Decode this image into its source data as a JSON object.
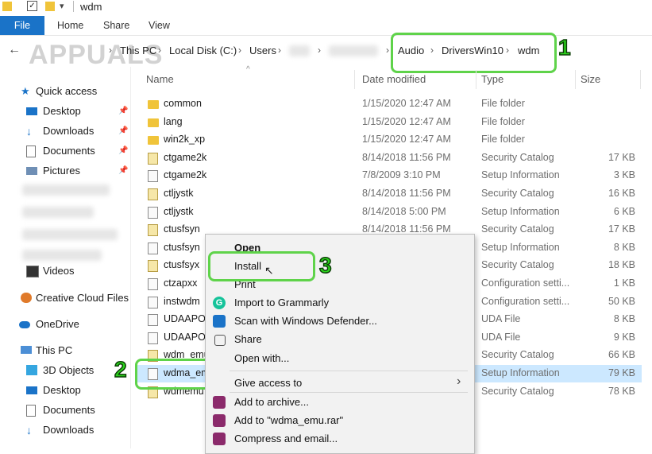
{
  "window": {
    "title": "wdm"
  },
  "ribbon": {
    "tabs": [
      "File",
      "Home",
      "Share",
      "View"
    ]
  },
  "watermark": "APPUALS",
  "address": {
    "crumbs": [
      "This PC",
      "Local Disk (C:)",
      "Users",
      "Audio",
      "DriversWin10",
      "wdm"
    ]
  },
  "nav": {
    "quick_access": "Quick access",
    "items": [
      "Desktop",
      "Downloads",
      "Documents",
      "Pictures",
      "Videos",
      "Creative Cloud Files",
      "OneDrive",
      "This PC",
      "3D Objects",
      "Desktop",
      "Documents",
      "Downloads"
    ]
  },
  "columns": {
    "name": "Name",
    "date": "Date modified",
    "type": "Type",
    "size": "Size"
  },
  "files": [
    {
      "name": "common",
      "date": "1/15/2020 12:47 AM",
      "type": "File folder",
      "size": "",
      "icon": "folder-icon"
    },
    {
      "name": "lang",
      "date": "1/15/2020 12:47 AM",
      "type": "File folder",
      "size": "",
      "icon": "folder-icon"
    },
    {
      "name": "win2k_xp",
      "date": "1/15/2020 12:47 AM",
      "type": "File folder",
      "size": "",
      "icon": "folder-icon"
    },
    {
      "name": "ctgame2k",
      "date": "8/14/2018 11:56 PM",
      "type": "Security Catalog",
      "size": "17 KB",
      "icon": "catalog-icon"
    },
    {
      "name": "ctgame2k",
      "date": "7/8/2009 3:10 PM",
      "type": "Setup Information",
      "size": "3 KB",
      "icon": "setup-file-icon"
    },
    {
      "name": "ctljystk",
      "date": "8/14/2018 11:56 PM",
      "type": "Security Catalog",
      "size": "16 KB",
      "icon": "catalog-icon"
    },
    {
      "name": "ctljystk",
      "date": "8/14/2018 5:00 PM",
      "type": "Setup Information",
      "size": "6 KB",
      "icon": "setup-file-icon"
    },
    {
      "name": "ctusfsyn",
      "date": "8/14/2018 11:56 PM",
      "type": "Security Catalog",
      "size": "17 KB",
      "icon": "catalog-icon"
    },
    {
      "name": "ctusfsyn",
      "date": "",
      "type": "Setup Information",
      "size": "8 KB",
      "icon": "setup-file-icon"
    },
    {
      "name": "ctusfsyx",
      "date": "",
      "type": "Security Catalog",
      "size": "18 KB",
      "icon": "catalog-icon"
    },
    {
      "name": "ctzapxx",
      "date": "",
      "type": "Configuration setti...",
      "size": "1 KB",
      "icon": "config-file-icon"
    },
    {
      "name": "instwdm",
      "date": "",
      "type": "Configuration setti...",
      "size": "50 KB",
      "icon": "config-file-icon"
    },
    {
      "name": "UDAAPO3",
      "date": "",
      "type": "UDA File",
      "size": "8 KB",
      "icon": "file-icon"
    },
    {
      "name": "UDAAPO6",
      "date": "",
      "type": "UDA File",
      "size": "9 KB",
      "icon": "file-icon"
    },
    {
      "name": "wdm_emu",
      "date": "",
      "type": "Security Catalog",
      "size": "66 KB",
      "icon": "catalog-icon"
    },
    {
      "name": "wdma_em",
      "date": "",
      "type": "Setup Information",
      "size": "79 KB",
      "icon": "setup-file-icon"
    },
    {
      "name": "wdmemu",
      "date": "",
      "type": "Security Catalog",
      "size": "78 KB",
      "icon": "catalog-icon"
    }
  ],
  "context_menu": {
    "open": "Open",
    "install": "Install",
    "print": "Print",
    "grammarly": "Import to Grammarly",
    "defender": "Scan with Windows Defender...",
    "share": "Share",
    "open_with": "Open with...",
    "give_access": "Give access to",
    "add_archive": "Add to archive...",
    "add_rar": "Add to \"wdma_emu.rar\"",
    "compress_email": "Compress and email..."
  },
  "annotations": {
    "one": "1",
    "two": "2",
    "three": "3"
  },
  "colors": {
    "accent": "#1a73c8",
    "selected_row": "#cce8ff",
    "annotation": "#5fd34a"
  }
}
